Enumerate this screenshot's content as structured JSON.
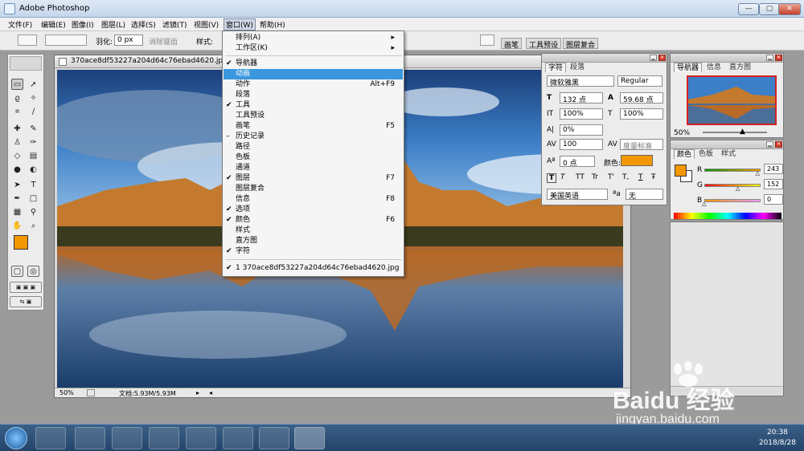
{
  "app_title": "Adobe Photoshop",
  "window_buttons": {
    "minimize": "—",
    "maximize": "▢",
    "close": "✕"
  },
  "menubar": [
    "文件(F)",
    "编辑(E)",
    "图像(I)",
    "图层(L)",
    "选择(S)",
    "滤镜(T)",
    "视图(V)",
    "窗口(W)",
    "帮助(H)"
  ],
  "options": {
    "feather_label": "羽化:",
    "feather_value": "0 px",
    "antialias_label": "消除锯齿",
    "style_label": "样式:"
  },
  "wells": [
    "画笔",
    "工具预设",
    "图层复合"
  ],
  "document": {
    "title": "370ace8df53227a204d64c76ebad4620.jpg @",
    "zoom": "50%",
    "doc_info": "文档:5.93M/5.93M"
  },
  "window_menu": {
    "items": [
      {
        "label": "排列(A)",
        "check": "",
        "shortcut": "▸"
      },
      {
        "label": "工作区(K)",
        "check": "",
        "shortcut": "▸"
      },
      {
        "label": "导航器",
        "check": "✔",
        "shortcut": ""
      },
      {
        "label": "动画",
        "check": "",
        "shortcut": "",
        "highlight": true
      },
      {
        "label": "动作",
        "check": "",
        "shortcut": "Alt+F9"
      },
      {
        "label": "段落",
        "check": "",
        "shortcut": ""
      },
      {
        "label": "工具",
        "check": "✔",
        "shortcut": ""
      },
      {
        "label": "工具预设",
        "check": "",
        "shortcut": ""
      },
      {
        "label": "画笔",
        "check": "",
        "shortcut": "F5"
      },
      {
        "label": "历史记录",
        "check": "–",
        "shortcut": ""
      },
      {
        "label": "路径",
        "check": "",
        "shortcut": ""
      },
      {
        "label": "色板",
        "check": "",
        "shortcut": ""
      },
      {
        "label": "通道",
        "check": "",
        "shortcut": ""
      },
      {
        "label": "图层",
        "check": "✔",
        "shortcut": "F7"
      },
      {
        "label": "图层复合",
        "check": "",
        "shortcut": ""
      },
      {
        "label": "信息",
        "check": "",
        "shortcut": "F8"
      },
      {
        "label": "选项",
        "check": "✔",
        "shortcut": ""
      },
      {
        "label": "颜色",
        "check": "✔",
        "shortcut": "F6"
      },
      {
        "label": "样式",
        "check": "",
        "shortcut": ""
      },
      {
        "label": "直方图",
        "check": "",
        "shortcut": ""
      },
      {
        "label": "字符",
        "check": "✔",
        "shortcut": ""
      }
    ],
    "recent_file": {
      "check": "✔",
      "label": "1 370ace8df53227a204d64c76ebad4620.jpg"
    }
  },
  "character_panel": {
    "tabs": [
      "字符",
      "段落"
    ],
    "font_family": "微软雅黑",
    "font_style": "Regular",
    "font_size": "132 点",
    "leading": "59.68 点",
    "vertical_scale": "100%",
    "horizontal_scale": "100%",
    "tracking_small": "0%",
    "tracking": "100",
    "kerning": "度量标准",
    "baseline": "0 点",
    "color_label": "颜色:",
    "color_value": "#f39800",
    "style_buttons": [
      "T",
      "T",
      "TT",
      "Tr",
      "T'",
      "T,",
      "T",
      "Ŧ"
    ],
    "language": "美国英语",
    "aa_label": "ªa",
    "aa_value": "无"
  },
  "navigator_panel": {
    "tabs": [
      "导航器",
      "信息",
      "直方图"
    ],
    "zoom": "50%"
  },
  "color_panel": {
    "tabs": [
      "颜色",
      "色板",
      "样式"
    ],
    "foreground": "#f39800",
    "channels": [
      {
        "name": "R",
        "value": "243",
        "level": 0.95
      },
      {
        "name": "G",
        "value": "152",
        "level": 0.6
      },
      {
        "name": "B",
        "value": "0",
        "level": 0.0
      }
    ]
  },
  "toolbox": {
    "foreground": "#f39800",
    "background": "#ffffff"
  },
  "taskbar": {
    "time": "20:38",
    "date": "2018/8/28"
  },
  "watermark": {
    "brand": "Baidu 经验",
    "url": "jingyan.baidu.com"
  }
}
